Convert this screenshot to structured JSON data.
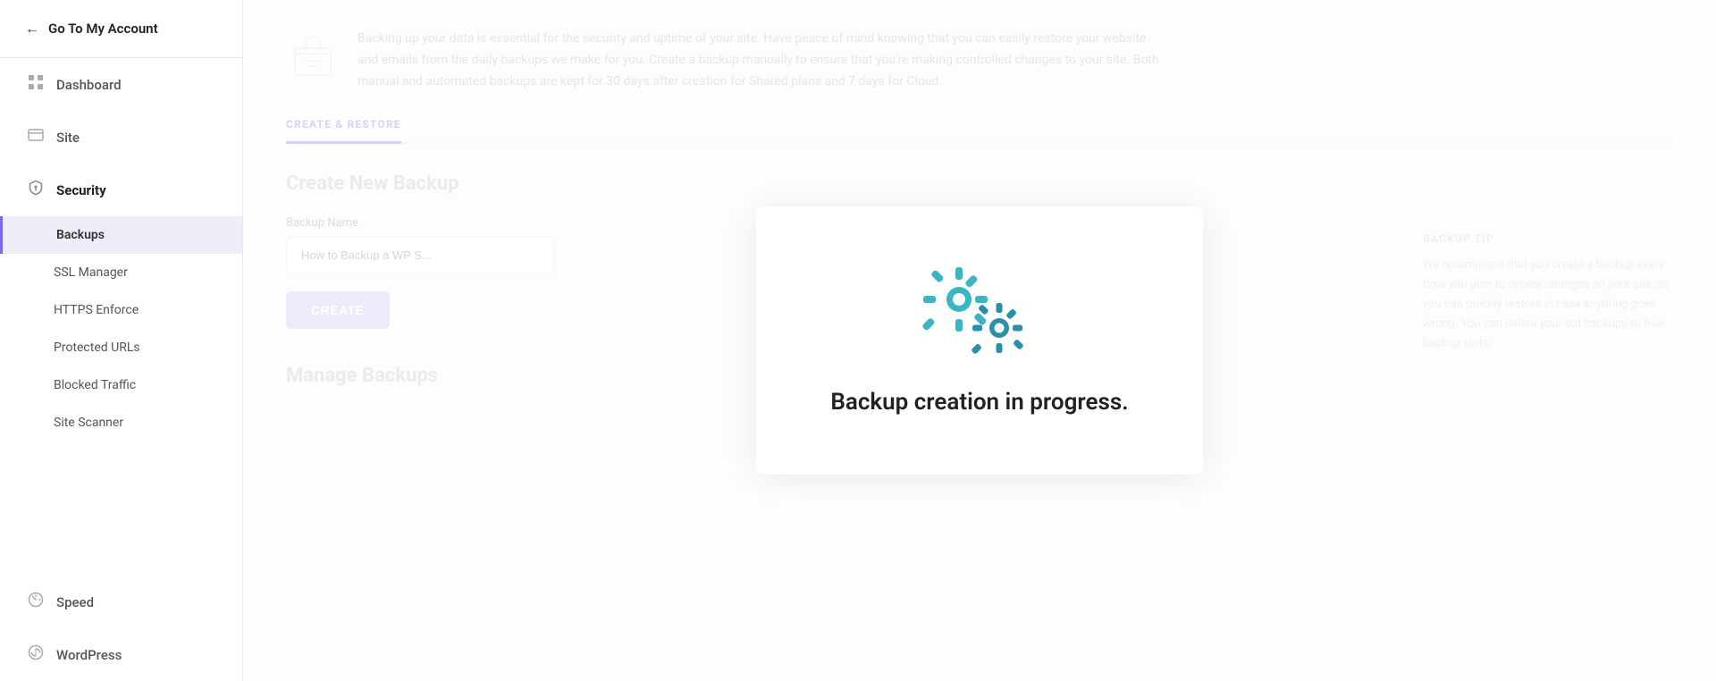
{
  "sidebar": {
    "go_to_account": "Go To My Account",
    "nav_items": [
      {
        "id": "dashboard",
        "label": "Dashboard",
        "icon": "⊞"
      },
      {
        "id": "site",
        "label": "Site",
        "icon": "☰"
      },
      {
        "id": "security",
        "label": "Security",
        "icon": "🔒",
        "active": true
      }
    ],
    "security_subnav": [
      {
        "id": "backups",
        "label": "Backups",
        "active": true
      },
      {
        "id": "ssl-manager",
        "label": "SSL Manager",
        "active": false
      },
      {
        "id": "https-enforce",
        "label": "HTTPS Enforce",
        "active": false
      },
      {
        "id": "protected-urls",
        "label": "Protected URLs",
        "active": false
      },
      {
        "id": "blocked-traffic",
        "label": "Blocked Traffic",
        "active": false
      },
      {
        "id": "site-scanner",
        "label": "Site Scanner",
        "active": false
      }
    ],
    "bottom_nav": [
      {
        "id": "speed",
        "label": "Speed",
        "icon": "⚡"
      },
      {
        "id": "wordpress",
        "label": "WordPress",
        "icon": "Ⓦ"
      }
    ]
  },
  "main": {
    "intro_text": "Backing up your data is essential for the security and uptime of your site. Have peace of mind knowing that you can easily restore your website and emails from the daily backups we make for you. Create a backup manually to ensure that you're making controlled changes to your site. Both manual and automated backups are kept for 30 days after creation for Shared plans and 7 days for Cloud.",
    "tabs": [
      {
        "id": "create-restore",
        "label": "CREATE & RESTORE",
        "active": true
      }
    ],
    "create_backup": {
      "title": "Create New Backup",
      "form_label": "Backup Name",
      "form_placeholder": "How to Backup a WP S...",
      "button_label": "CREATE"
    },
    "manage_backups": {
      "title": "Manage Backups"
    },
    "backup_tip": {
      "title": "BACKUP TIP",
      "text": "We recommend that you create a backup every time you plan to deploy changes on your site, so you can quickly restore in case anything goes wrong. You can delete your old backups to free backup slots."
    }
  },
  "modal": {
    "text": "Backup creation in progress."
  }
}
